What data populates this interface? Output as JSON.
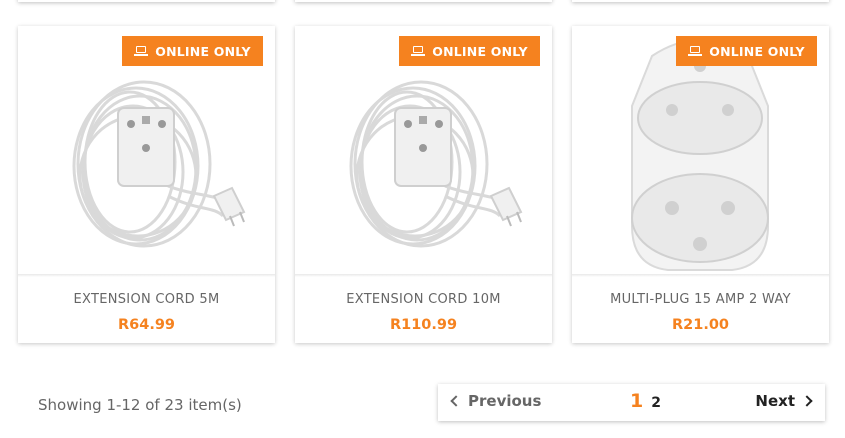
{
  "badge_label": "ONLINE ONLY",
  "products": [
    {
      "name": "EXTENSION CORD 5M",
      "price": "R64.99",
      "image": "extension-cord-image"
    },
    {
      "name": "EXTENSION CORD 10M",
      "price": "R110.99",
      "image": "extension-cord-image"
    },
    {
      "name": "MULTI-PLUG 15 AMP 2 WAY",
      "price": "R21.00",
      "image": "multi-plug-image"
    }
  ],
  "pagination": {
    "summary": "Showing 1-12 of 23 item(s)",
    "previous_label": "Previous",
    "next_label": "Next",
    "current_page": "1",
    "other_page": "2"
  },
  "colors": {
    "accent": "#f5821f",
    "text": "#666666"
  }
}
